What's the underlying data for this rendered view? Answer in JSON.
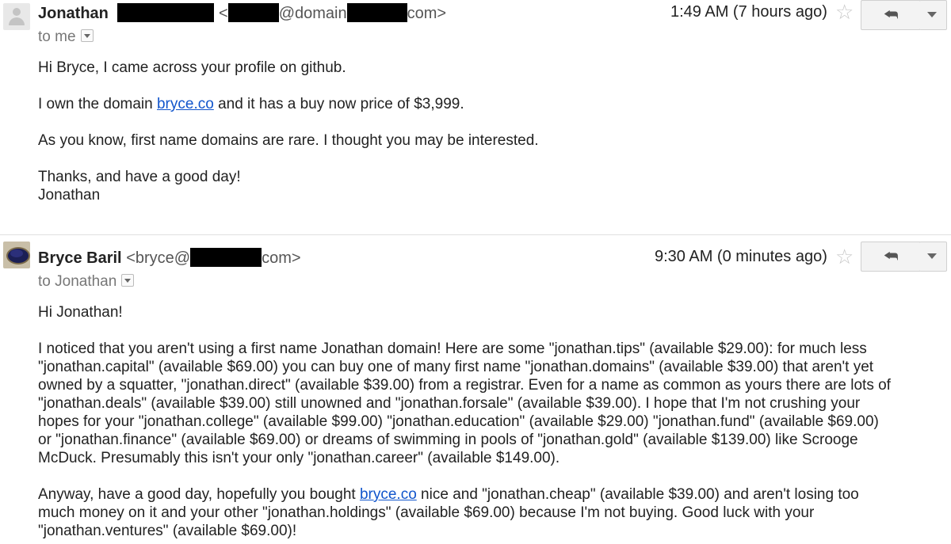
{
  "message1": {
    "sender_name": "Jonathan",
    "email_open": "<",
    "email_mid": "@domain",
    "email_close": "com>",
    "time": "1:49 AM (7 hours ago)",
    "to": "to me",
    "greeting": "Hi Bryce, I came across your profile on github.",
    "line2_before": "I own the domain ",
    "line2_link": "bryce.co",
    "line2_after": " and it has a buy now price of $3,999.",
    "line3": "As you know, first name domains are rare. I thought you may be interested.",
    "signoff": "Thanks, and have a good day!",
    "signature": "Jonathan"
  },
  "message2": {
    "sender_name": "Bryce Baril",
    "email_open": "<bryce@",
    "email_close": "com>",
    "time": "9:30 AM (0 minutes ago)",
    "to": "to Jonathan",
    "greeting": "Hi Jonathan!",
    "para1": [
      "I noticed that you aren't using a first name Jonathan domain! Here are some \"jonathan.tips\" (available $29.00): for much less",
      "\"jonathan.capital\" (available $69.00) you can buy one of many first name \"jonathan.domains\" (available $39.00) that aren't yet",
      "owned by a squatter, \"jonathan.direct\" (available $39.00) from a registrar. Even for a name as common as yours there are lots of",
      "\"jonathan.deals\" (available $39.00) still unowned and \"jonathan.forsale\" (available $39.00). I hope that I'm not crushing your",
      "hopes for your \"jonathan.college\" (available $99.00) \"jonathan.education\" (available $29.00) \"jonathan.fund\" (available $69.00)",
      "or \"jonathan.finance\" (available $69.00) or dreams of swimming in pools of \"jonathan.gold\" (available $139.00) like Scrooge",
      "McDuck. Presumably this isn't your only \"jonathan.career\" (available $149.00)."
    ],
    "para2_l1_before": "Anyway, have a good day, hopefully you bought ",
    "para2_l1_link": "bryce.co",
    "para2_l1_after": " nice and \"jonathan.cheap\" (available $39.00) and aren't losing too",
    "para2_l2": "much money on it and your other \"jonathan.holdings\" (available $69.00) because I'm not buying. Good luck with your",
    "para2_l3": "\"jonathan.ventures\" (available $69.00)!"
  },
  "icons": {
    "star": "star-icon",
    "reply": "reply-arrow-icon",
    "more": "chevron-down-icon"
  }
}
